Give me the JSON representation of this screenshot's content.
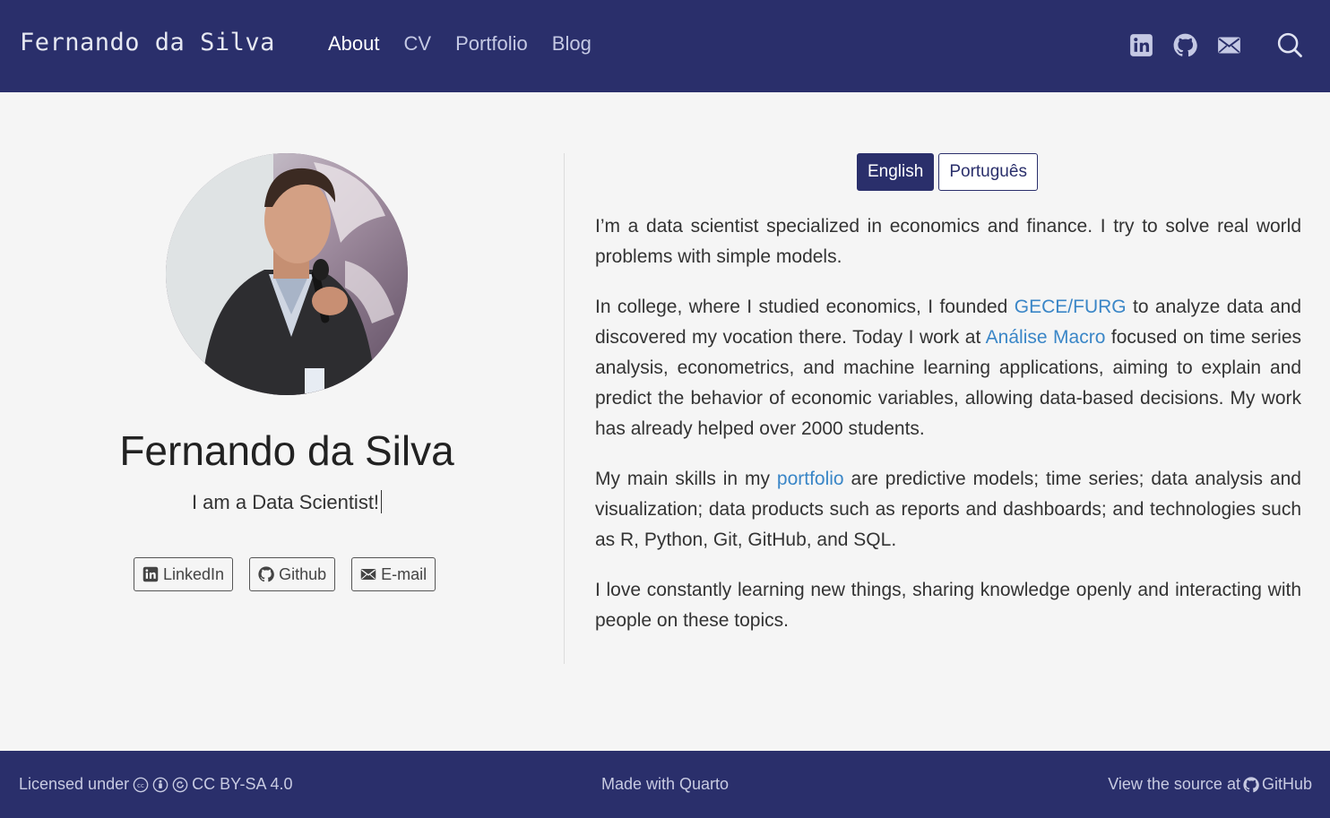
{
  "header": {
    "brand": "Fernando da Silva",
    "nav": [
      {
        "label": "About",
        "active": true
      },
      {
        "label": "CV",
        "active": false
      },
      {
        "label": "Portfolio",
        "active": false
      },
      {
        "label": "Blog",
        "active": false
      }
    ],
    "icons": [
      "linkedin-icon",
      "github-icon",
      "email-icon",
      "search-icon"
    ]
  },
  "profile": {
    "name": "Fernando da Silva",
    "tagline": "I am a Data Scientist!",
    "links": [
      {
        "label": "LinkedIn",
        "icon": "linkedin-icon"
      },
      {
        "label": "Github",
        "icon": "github-icon"
      },
      {
        "label": "E-mail",
        "icon": "email-icon"
      }
    ]
  },
  "language": {
    "options": [
      "English",
      "Português"
    ],
    "selected": "English"
  },
  "about": {
    "p1": "I’m a data scientist specialized in economics and finance. I try to solve real world problems with simple models.",
    "p2_a": "In college, where I studied economics, I founded ",
    "p2_link1": "GECE/FURG",
    "p2_b": " to analyze data and discovered my vocation there. Today I work at ",
    "p2_link2": "Análise Macro",
    "p2_c": " focused on time series analysis, econometrics, and machine learning applications, aiming to explain and predict the behavior of economic variables, allowing data-based decisions. My work has already helped over 2000 students.",
    "p3_a": "My main skills in my ",
    "p3_link": "portfolio",
    "p3_b": " are predictive models; time series; data analysis and visualization; data products such as reports and dashboards; and technologies such as R, Python, Git, GitHub, and SQL.",
    "p4": "I love constantly learning new things, sharing knowledge openly and interacting with people on these topics."
  },
  "footer": {
    "license_prefix": "Licensed under",
    "license": "CC BY-SA 4.0",
    "made_with": "Made with Quarto",
    "source_prefix": "View the source at",
    "source_link": "GitHub"
  },
  "colors": {
    "navbar": "#2a2f6b",
    "link": "#3a86c7",
    "background": "#f5f5f5"
  }
}
